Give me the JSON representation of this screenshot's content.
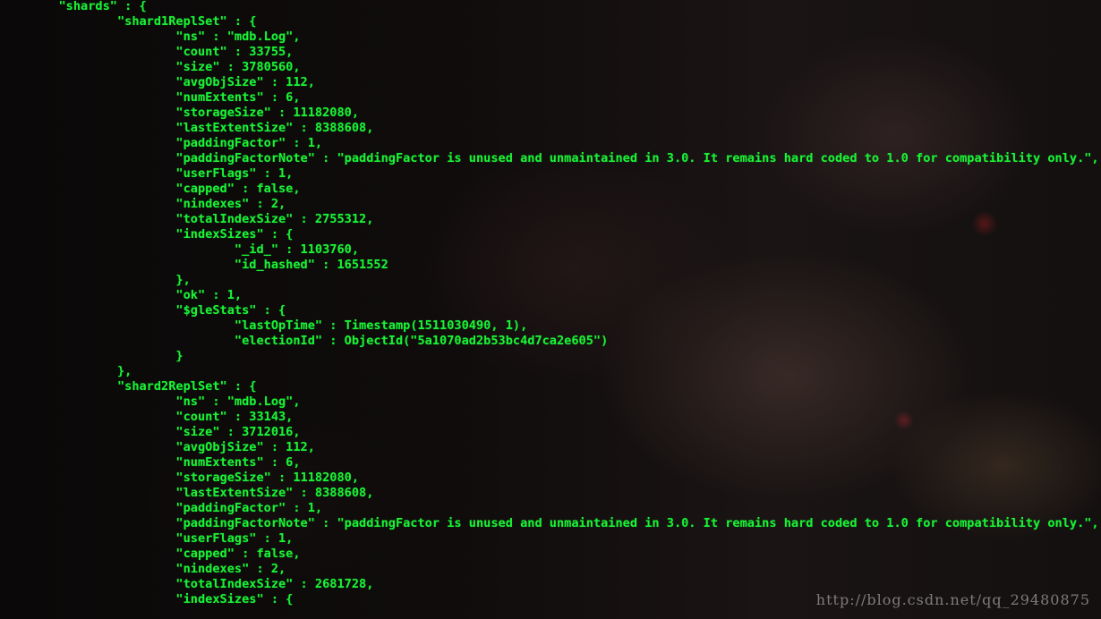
{
  "terminal": {
    "lines": [
      "        \"shards\" : {",
      "                \"shard1ReplSet\" : {",
      "                        \"ns\" : \"mdb.Log\",",
      "                        \"count\" : 33755,",
      "                        \"size\" : 3780560,",
      "                        \"avgObjSize\" : 112,",
      "                        \"numExtents\" : 6,",
      "                        \"storageSize\" : 11182080,",
      "                        \"lastExtentSize\" : 8388608,",
      "                        \"paddingFactor\" : 1,",
      "                        \"paddingFactorNote\" : \"paddingFactor is unused and unmaintained in 3.0. It remains hard coded to 1.0 for compatibility only.\",",
      "                        \"userFlags\" : 1,",
      "                        \"capped\" : false,",
      "                        \"nindexes\" : 2,",
      "                        \"totalIndexSize\" : 2755312,",
      "                        \"indexSizes\" : {",
      "                                \"_id_\" : 1103760,",
      "                                \"id_hashed\" : 1651552",
      "                        },",
      "                        \"ok\" : 1,",
      "                        \"$gleStats\" : {",
      "                                \"lastOpTime\" : Timestamp(1511030490, 1),",
      "                                \"electionId\" : ObjectId(\"5a1070ad2b53bc4d7ca2e605\")",
      "                        }",
      "                },",
      "                \"shard2ReplSet\" : {",
      "                        \"ns\" : \"mdb.Log\",",
      "                        \"count\" : 33143,",
      "                        \"size\" : 3712016,",
      "                        \"avgObjSize\" : 112,",
      "                        \"numExtents\" : 6,",
      "                        \"storageSize\" : 11182080,",
      "                        \"lastExtentSize\" : 8388608,",
      "                        \"paddingFactor\" : 1,",
      "                        \"paddingFactorNote\" : \"paddingFactor is unused and unmaintained in 3.0. It remains hard coded to 1.0 for compatibility only.\",",
      "                        \"userFlags\" : 1,",
      "                        \"capped\" : false,",
      "                        \"nindexes\" : 2,",
      "                        \"totalIndexSize\" : 2681728,",
      "                        \"indexSizes\" : {"
    ]
  },
  "watermark": "http://blog.csdn.net/qq_29480875",
  "colors": {
    "text": "#19f235",
    "background": "#0c0a0a"
  }
}
